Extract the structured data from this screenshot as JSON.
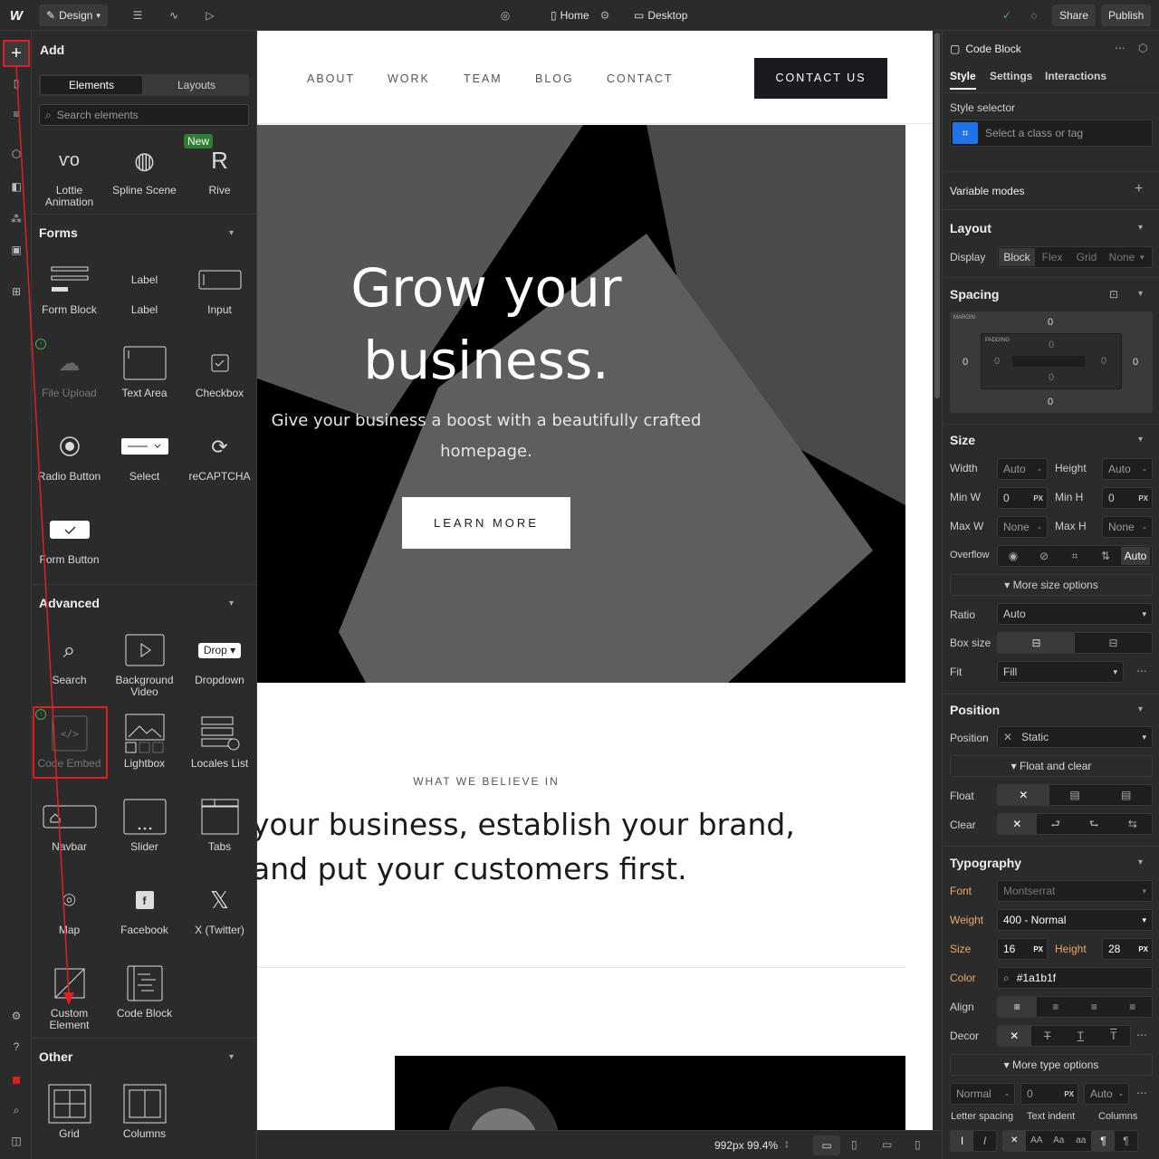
{
  "topbar": {
    "mode_label": "Design",
    "page_label": "Home",
    "breakpoint_label": "Desktop",
    "share_label": "Share",
    "publish_label": "Publish"
  },
  "add_panel": {
    "title": "Add",
    "tabs": [
      "Elements",
      "Layouts"
    ],
    "search_placeholder": "Search elements",
    "top_items": [
      {
        "label": "Lottie Animation",
        "icon": "lottie-icon"
      },
      {
        "label": "Spline Scene",
        "icon": "spline-icon"
      },
      {
        "label": "Rive",
        "icon": "rive-icon",
        "badge": "New"
      }
    ],
    "forms": {
      "title": "Forms",
      "items": [
        {
          "label": "Form Block"
        },
        {
          "label": "Label",
          "inner": "Label"
        },
        {
          "label": "Input"
        },
        {
          "label": "File Upload"
        },
        {
          "label": "Text Area"
        },
        {
          "label": "Checkbox"
        },
        {
          "label": "Radio Button"
        },
        {
          "label": "Select"
        },
        {
          "label": "reCAPTCHA"
        },
        {
          "label": "Form Button"
        }
      ]
    },
    "advanced": {
      "title": "Advanced",
      "items": [
        {
          "label": "Search"
        },
        {
          "label": "Background Video"
        },
        {
          "label": "Dropdown",
          "inner": "Drop"
        },
        {
          "label": "Code Embed"
        },
        {
          "label": "Lightbox"
        },
        {
          "label": "Locales List"
        },
        {
          "label": "Navbar"
        },
        {
          "label": "Slider"
        },
        {
          "label": "Tabs"
        },
        {
          "label": "Map"
        },
        {
          "label": "Facebook"
        },
        {
          "label": "X (Twitter)"
        },
        {
          "label": "Custom Element"
        },
        {
          "label": "Code Block"
        }
      ]
    },
    "other": {
      "title": "Other",
      "items": [
        {
          "label": "Grid"
        },
        {
          "label": "Columns"
        }
      ]
    }
  },
  "canvas": {
    "nav": [
      "ABOUT",
      "WORK",
      "TEAM",
      "BLOG",
      "CONTACT"
    ],
    "cta": "CONTACT US",
    "hero_title_1": "Grow your",
    "hero_title_2": "business.",
    "hero_sub_1": "Give your business a boost with a beautifully crafted",
    "hero_sub_2": "homepage.",
    "hero_button": "LEARN MORE",
    "believe_label": "WHAT WE BELIEVE IN",
    "believe_1": "your business, establish your brand,",
    "believe_2": "and put your customers first."
  },
  "bottombar": {
    "width_readout": "992px 99.4%"
  },
  "right": {
    "element_name": "Code Block",
    "tabs": [
      "Style",
      "Settings",
      "Interactions"
    ],
    "style_selector_label": "Style selector",
    "selector_placeholder": "Select a class or tag",
    "variable_modes": "Variable modes",
    "layout": {
      "title": "Layout",
      "display_label": "Display",
      "options": [
        "Block",
        "Flex",
        "Grid",
        "None"
      ]
    },
    "spacing": {
      "title": "Spacing",
      "margin_label": "MARGIN",
      "padding_label": "PADDING",
      "margin": [
        "0",
        "0",
        "0",
        "0"
      ],
      "padding": [
        "0",
        "0",
        "0",
        "0"
      ]
    },
    "size": {
      "title": "Size",
      "width_label": "Width",
      "width": "Auto",
      "height_label": "Height",
      "height": "Auto",
      "minw_label": "Min W",
      "minw": "0",
      "minh_label": "Min H",
      "minh": "0",
      "maxw_label": "Max W",
      "maxw": "None",
      "maxh_label": "Max H",
      "maxh": "None",
      "unit": "PX",
      "overflow_label": "Overflow",
      "overflow_auto": "Auto",
      "more": "More size options",
      "ratio_label": "Ratio",
      "ratio": "Auto",
      "boxsize_label": "Box size",
      "fit_label": "Fit",
      "fit": "Fill"
    },
    "position": {
      "title": "Position",
      "position_label": "Position",
      "position": "Static",
      "float_clear": "Float and clear",
      "float_label": "Float",
      "clear_label": "Clear"
    },
    "typography": {
      "title": "Typography",
      "font_label": "Font",
      "font": "Montserrat",
      "weight_label": "Weight",
      "weight": "400 - Normal",
      "size_label": "Size",
      "size": "16",
      "height_label": "Height",
      "height": "28",
      "color_label": "Color",
      "color": "#1a1b1f",
      "align_label": "Align",
      "decor_label": "Decor",
      "more": "More type options",
      "letter_spacing": "Normal",
      "text_indent": "0",
      "columns": "Auto",
      "letter_spacing_label": "Letter spacing",
      "text_indent_label": "Text indent",
      "columns_label": "Columns"
    }
  },
  "colors": {
    "accent": "#1e73e8",
    "annotation": "#e02020",
    "green": "#4caf50"
  }
}
